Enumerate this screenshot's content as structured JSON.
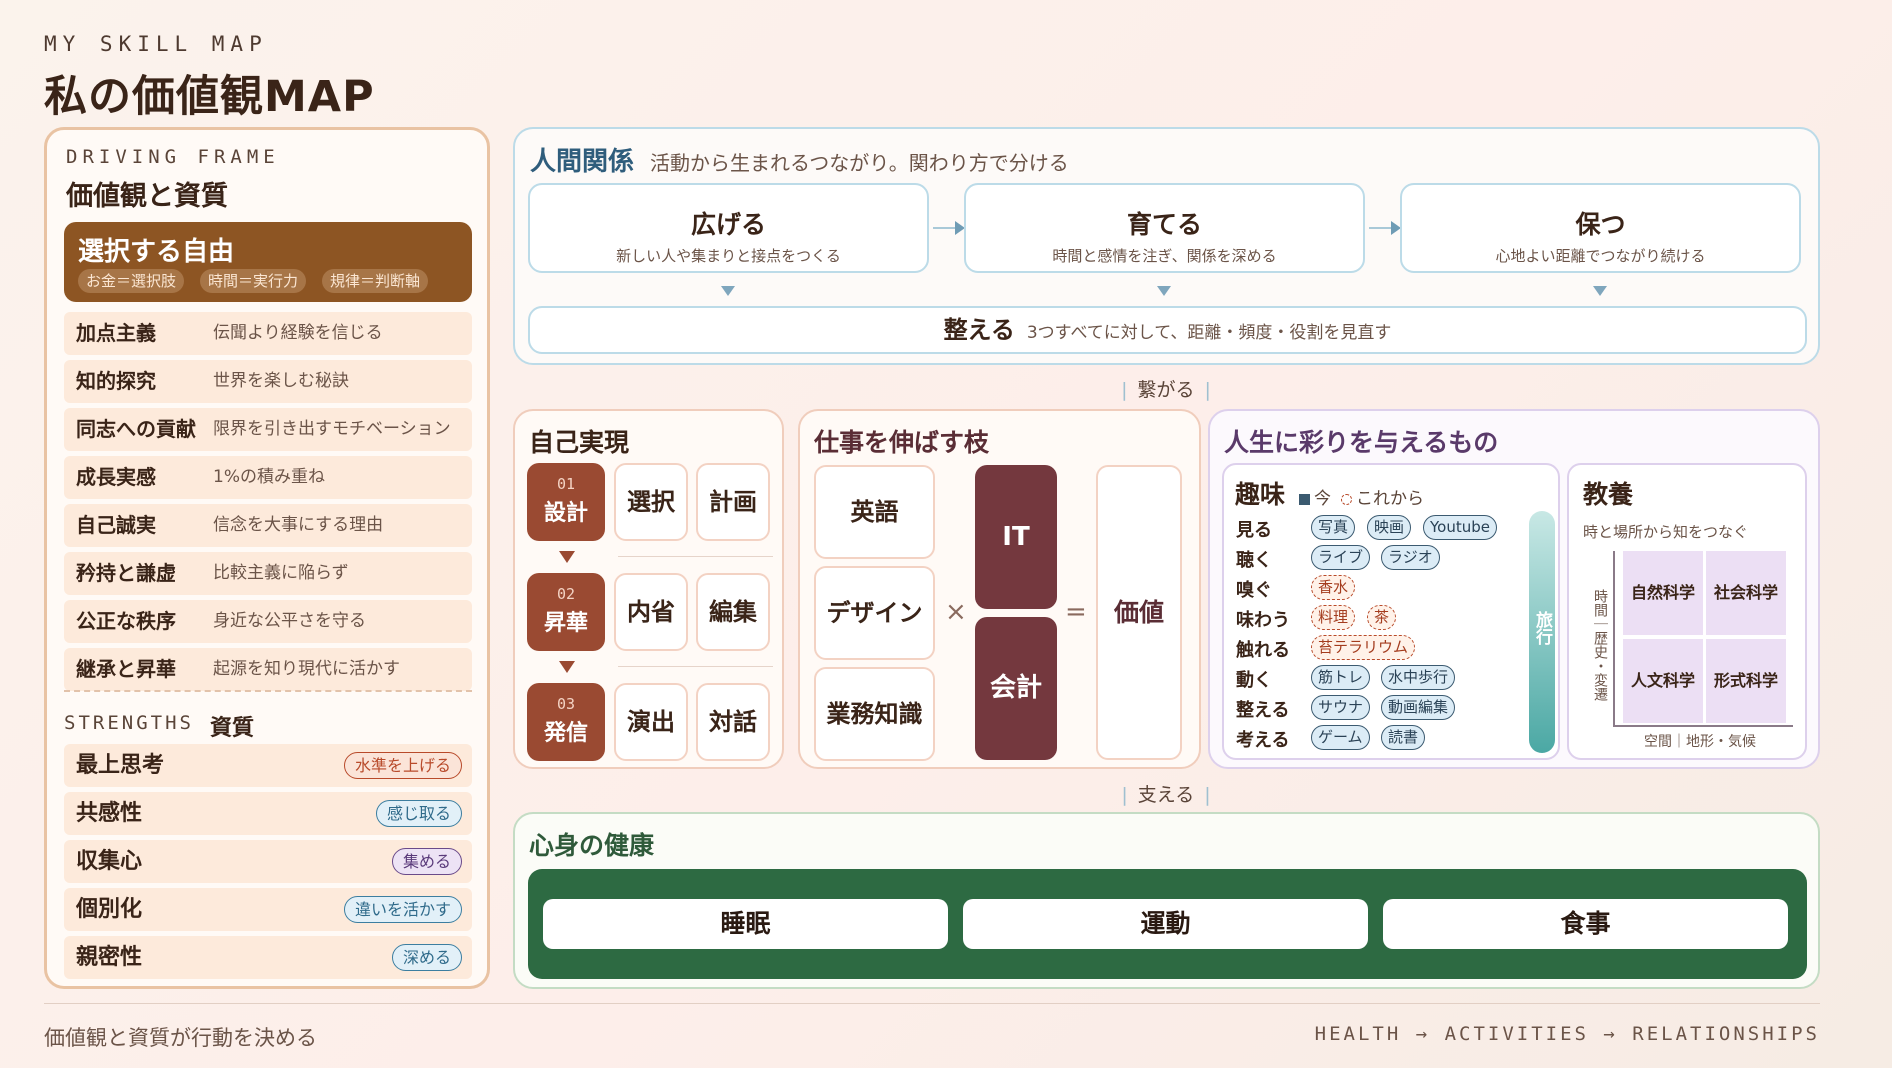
{
  "header": {
    "eyebrow": "MY SKILL MAP",
    "title": "私の価値観MAP"
  },
  "left": {
    "eyebrow": "DRIVING FRAME",
    "title": "価値観と資質",
    "freedom": {
      "title": "選択する自由",
      "chips": [
        "お金＝選択肢",
        "時間＝実行力",
        "規律＝判断軸"
      ]
    },
    "values": [
      {
        "name": "加点主義",
        "desc": "伝聞より経験を信じる"
      },
      {
        "name": "知的探究",
        "desc": "世界を楽しむ秘訣"
      },
      {
        "name": "同志への貢献",
        "desc": "限界を引き出すモチベーション"
      },
      {
        "name": "成長実感",
        "desc": "1%の積み重ね"
      },
      {
        "name": "自己誠実",
        "desc": "信念を大事にする理由"
      },
      {
        "name": "矜持と謙虚",
        "desc": "比較主義に陥らず"
      },
      {
        "name": "公正な秩序",
        "desc": "身近な公平さを守る"
      },
      {
        "name": "継承と昇華",
        "desc": "起源を知り現代に活かす"
      }
    ],
    "strengths_eyebrow": "STRENGTHS",
    "strengths_jp": "資質",
    "strengths": [
      {
        "name": "最上思考",
        "badge": "水準を上げる",
        "color": "#b84a2a",
        "bg": "#fbe4d8"
      },
      {
        "name": "共感性",
        "badge": "感じ取る",
        "color": "#3c7ea0",
        "bg": "#e2f0f8"
      },
      {
        "name": "収集心",
        "badge": "集める",
        "color": "#6a4a8a",
        "bg": "#ede3f5"
      },
      {
        "name": "個別化",
        "badge": "違いを活かす",
        "color": "#3c7ea0",
        "bg": "#e2f0f8"
      },
      {
        "name": "親密性",
        "badge": "深める",
        "color": "#3c7ea0",
        "bg": "#e2f0f8"
      }
    ]
  },
  "relationships": {
    "title": "人間関係",
    "subtitle": "活動から生まれるつながり。関わり方で分ける",
    "cards": [
      {
        "title": "広げる",
        "sub": "新しい人や集まりと接点をつくる"
      },
      {
        "title": "育てる",
        "sub": "時間と感情を注ぎ、関係を深める"
      },
      {
        "title": "保つ",
        "sub": "心地よい距離でつながり続ける"
      }
    ],
    "arrange": {
      "title": "整える",
      "sub": "3つすべてに対して、距離・頻度・役割を見直す"
    }
  },
  "connectors": {
    "top": "繋がる",
    "bottom": "支える"
  },
  "self": {
    "title": "自己実現",
    "steps": [
      {
        "num": "01",
        "label": "設計",
        "items": [
          "選択",
          "計画"
        ]
      },
      {
        "num": "02",
        "label": "昇華",
        "items": [
          "内省",
          "編集"
        ]
      },
      {
        "num": "03",
        "label": "発信",
        "items": [
          "演出",
          "対話"
        ]
      }
    ]
  },
  "work": {
    "title": "仕事を伸ばす枝",
    "skills": [
      "英語",
      "デザイン",
      "業務知識"
    ],
    "times": "×",
    "equals": "=",
    "core": [
      "IT",
      "会計"
    ],
    "result": "価値"
  },
  "life": {
    "title": "人生に彩りを与えるもの",
    "hobby": {
      "title": "趣味",
      "legend_now": "今",
      "legend_future": "これから",
      "rows": [
        {
          "sense": "見る",
          "tags": [
            {
              "t": "写真",
              "k": "now"
            },
            {
              "t": "映画",
              "k": "now"
            },
            {
              "t": "Youtube",
              "k": "now"
            }
          ]
        },
        {
          "sense": "聴く",
          "tags": [
            {
              "t": "ライブ",
              "k": "now"
            },
            {
              "t": "ラジオ",
              "k": "now"
            }
          ]
        },
        {
          "sense": "嗅ぐ",
          "tags": [
            {
              "t": "香水",
              "k": "fut"
            }
          ]
        },
        {
          "sense": "味わう",
          "tags": [
            {
              "t": "料理",
              "k": "fut"
            },
            {
              "t": "茶",
              "k": "fut"
            }
          ]
        },
        {
          "sense": "触れる",
          "tags": [
            {
              "t": "苔テラリウム",
              "k": "fut"
            }
          ]
        },
        {
          "sense": "動く",
          "tags": [
            {
              "t": "筋トレ",
              "k": "now"
            },
            {
              "t": "水中歩行",
              "k": "now"
            }
          ]
        },
        {
          "sense": "整える",
          "tags": [
            {
              "t": "サウナ",
              "k": "now"
            },
            {
              "t": "動画編集",
              "k": "now"
            }
          ]
        },
        {
          "sense": "考える",
          "tags": [
            {
              "t": "ゲーム",
              "k": "now"
            },
            {
              "t": "読書",
              "k": "now"
            }
          ]
        }
      ],
      "travel": "旅行"
    },
    "culture": {
      "title": "教養",
      "sub": "時と場所から知をつなぐ",
      "axis_v": "時間｜歴史・変遷",
      "axis_h": "空間｜地形・気候",
      "sciences": [
        "自然科学",
        "社会科学",
        "人文科学",
        "形式科学"
      ]
    }
  },
  "health": {
    "title": "心身の健康",
    "items": [
      "睡眠",
      "運動",
      "食事"
    ]
  },
  "footer": {
    "left": "価値観と資質が行動を決める",
    "right": "HEALTH → ACTIVITIES → RELATIONSHIPS"
  }
}
